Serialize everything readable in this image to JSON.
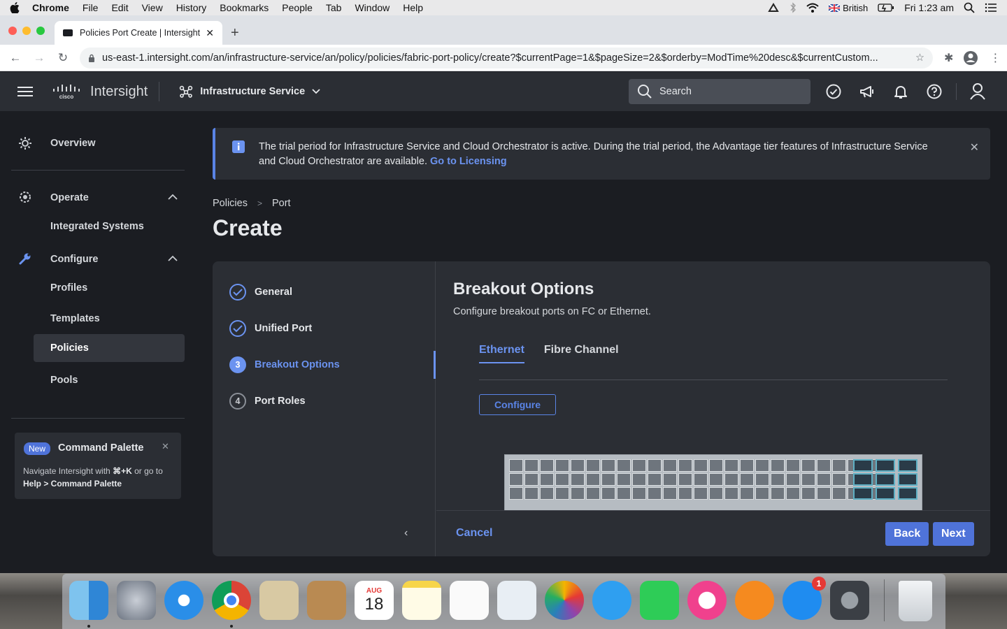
{
  "menubar": {
    "app": "Chrome",
    "items": [
      "File",
      "Edit",
      "View",
      "History",
      "Bookmarks",
      "People",
      "Tab",
      "Window",
      "Help"
    ],
    "input_source": "British",
    "clock": "Fri 1:23 am"
  },
  "browser": {
    "tab_title": "Policies Port Create | Intersight",
    "url": "us-east-1.intersight.com/an/infrastructure-service/an/policy/policies/fabric-port-policy/create?$currentPage=1&$pageSize=2&$orderby=ModTime%20desc&$currentCustom..."
  },
  "header": {
    "brand": "Intersight",
    "service": "Infrastructure Service",
    "search_placeholder": "Search"
  },
  "sidebar": {
    "overview": "Overview",
    "operate": "Operate",
    "integrated_systems": "Integrated Systems",
    "configure": "Configure",
    "profiles": "Profiles",
    "templates": "Templates",
    "policies": "Policies",
    "pools": "Pools"
  },
  "command_palette": {
    "badge": "New",
    "title": "Command Palette",
    "text_prefix": "Navigate Intersight with ",
    "shortcut": "⌘+K",
    "text_mid": " or go to ",
    "path": "Help > Command Palette"
  },
  "banner": {
    "text": "The trial period for Infrastructure Service and Cloud Orchestrator is active. During the trial period, the Advantage tier features of Infrastructure Service and Cloud Orchestrator are available.",
    "link": "Go to Licensing"
  },
  "breadcrumb": [
    "Policies",
    "Port"
  ],
  "page_title": "Create",
  "wizard": {
    "steps": [
      {
        "num": "1",
        "label": "General",
        "state": "done"
      },
      {
        "num": "2",
        "label": "Unified Port",
        "state": "done"
      },
      {
        "num": "3",
        "label": "Breakout Options",
        "state": "active"
      },
      {
        "num": "4",
        "label": "Port Roles",
        "state": "todo"
      }
    ],
    "title": "Breakout Options",
    "description": "Configure breakout ports on FC or Ethernet.",
    "tabs": [
      "Ethernet",
      "Fibre Channel"
    ],
    "configure_label": "Configure",
    "cancel_label": "Cancel",
    "back_label": "Back",
    "next_label": "Next"
  },
  "dock": {
    "calendar_month": "AUG",
    "calendar_day": "18",
    "appstore_badge": "1"
  }
}
